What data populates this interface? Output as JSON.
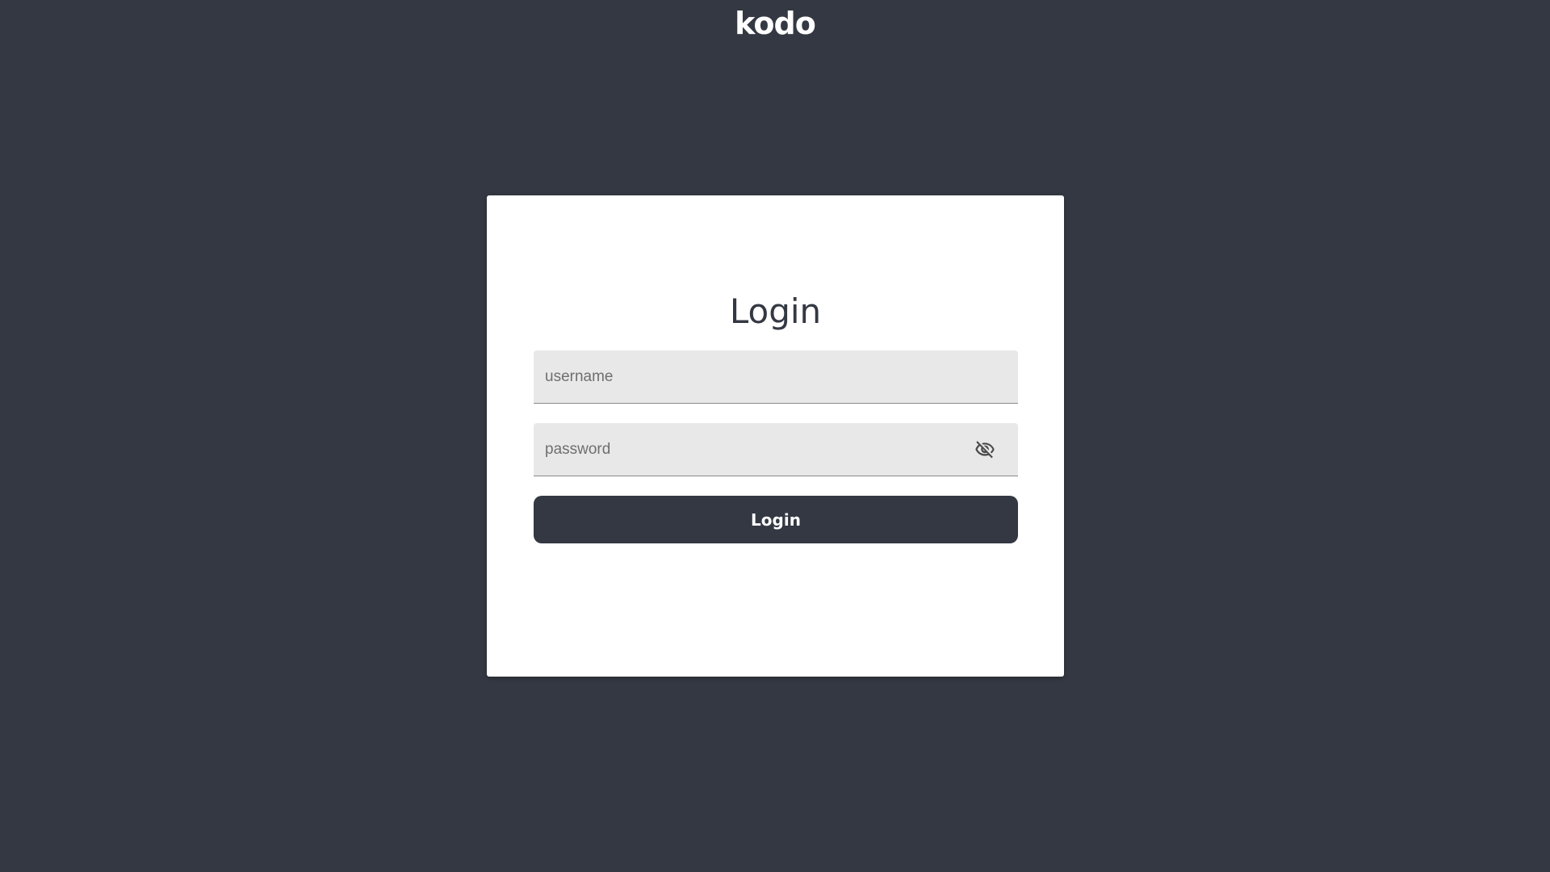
{
  "app": {
    "logo_text": "kodo"
  },
  "login": {
    "title": "Login",
    "username": {
      "value": "",
      "placeholder": "username"
    },
    "password": {
      "value": "",
      "placeholder": "password",
      "toggle_icon": "eye-off-icon"
    },
    "submit_label": "Login"
  },
  "colors": {
    "background": "#333842",
    "card": "#ffffff",
    "field_fill": "#e8e8e8",
    "button": "#333842",
    "button_text": "#ffffff"
  }
}
